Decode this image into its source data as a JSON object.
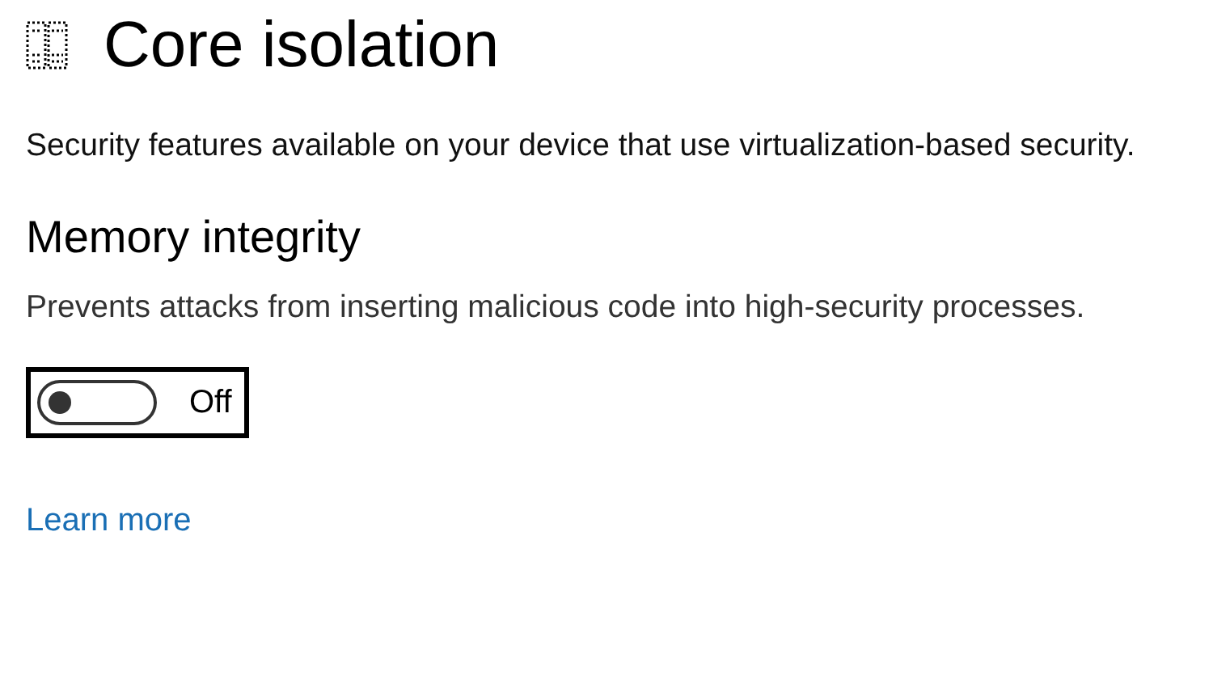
{
  "page": {
    "title": "Core isolation",
    "description": "Security features available on your device that use virtualization-based security."
  },
  "section": {
    "title": "Memory integrity",
    "description": "Prevents attacks from inserting malicious code into high-security processes.",
    "toggle": {
      "on": false,
      "label": "Off"
    }
  },
  "link": "Learn more"
}
